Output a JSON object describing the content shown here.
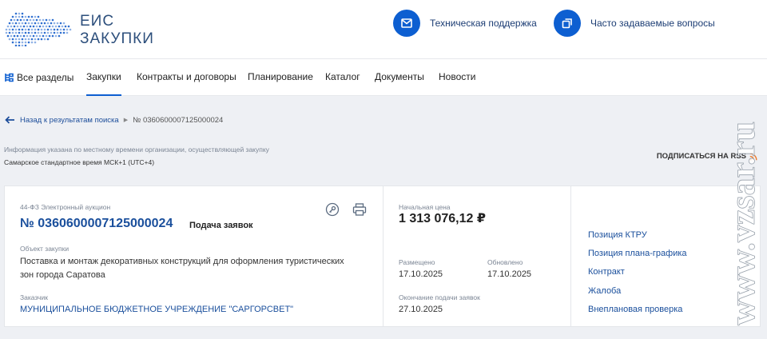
{
  "header": {
    "logo_line1": "ЕИС",
    "logo_line2": "ЗАКУПКИ",
    "links": [
      {
        "label": "Техническая поддержка",
        "icon": "mail-icon"
      },
      {
        "label": "Часто задаваемые вопросы",
        "icon": "copy-icon"
      }
    ]
  },
  "nav": {
    "items": [
      "Все разделы",
      "Закупки",
      "Контракты и договоры",
      "Планирование",
      "Каталог",
      "Документы",
      "Новости"
    ],
    "active": "Закупки"
  },
  "breadcrumb": {
    "back": "Назад к результатам поиска",
    "current": "№ 0360600007125000024"
  },
  "tz": {
    "info": "Информация указана по местному времени организации, осуществляющей закупку",
    "value": "Самарское стандартное время МСК+1 (UTC+4)"
  },
  "rss": {
    "label": "ПОДПИСАТЬСЯ НА RSS"
  },
  "card": {
    "type": "44-ФЗ  Электронный аукцион",
    "number": "№ 0360600007125000024",
    "status": "Подача заявок",
    "object_label": "Объект закупки",
    "object_lines": [
      "Поставка и монтаж декоративных конструкций для оформления туристических",
      "зон города Саратова"
    ],
    "customer_label": "Заказчик",
    "customer": "МУНИЦИПАЛЬНОЕ БЮДЖЕТНОЕ УЧРЕЖДЕНИЕ \"САРГОРСВЕТ\"",
    "price_label": "Начальная цена",
    "price": "1 313 076,12 ₽",
    "placed_label": "Размещено",
    "placed": "17.10.2025",
    "updated_label": "Обновлено",
    "updated": "17.10.2025",
    "deadline_label": "Окончание подачи заявок",
    "deadline": "27.10.2025",
    "links": [
      "Позиция КТРУ",
      "Позиция плана-графика",
      "Контракт",
      "Жалоба",
      "Внеплановая проверка"
    ]
  },
  "watermark": "www.vzsar.ru",
  "colors": {
    "accent": "#0d5fd1",
    "link": "#1a4f9c",
    "rss": "#ee7a2b"
  }
}
